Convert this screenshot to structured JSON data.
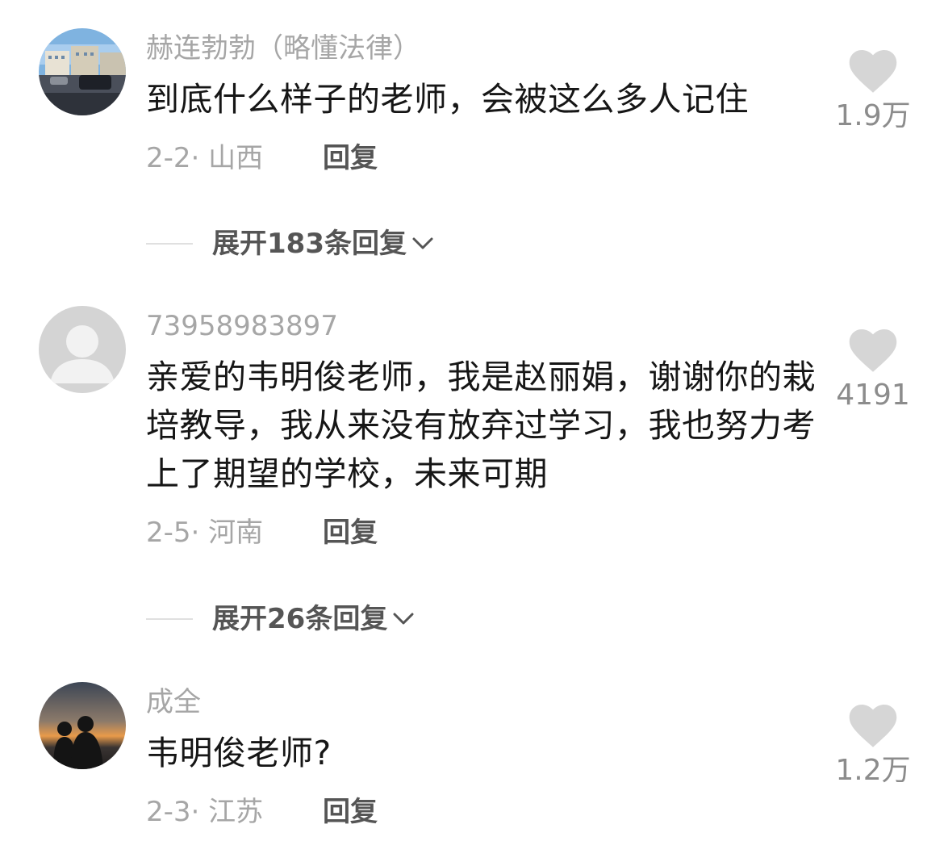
{
  "comments": [
    {
      "username": "赫连勃勃（略懂法律）",
      "text": "到底什么样子的老师，会被这么多人记住",
      "date_location": "2-2· 山西",
      "reply_label": "回复",
      "likes": "1.9万",
      "expand_label": "展开183条回复",
      "avatar_icon": "street-photo-avatar"
    },
    {
      "username": "73958983897",
      "text": "亲爱的韦明俊老师，我是赵丽娟，谢谢你的栽培教导，我从来没有放弃过学习，我也努力考上了期望的学校，未来可期",
      "date_location": "2-5· 河南",
      "reply_label": "回复",
      "likes": "4191",
      "expand_label": "展开26条回复",
      "avatar_icon": "default-user-avatar"
    },
    {
      "username": "成全",
      "text": "韦明俊老师?",
      "date_location": "2-3· 江苏",
      "reply_label": "回复",
      "likes": "1.2万",
      "avatar_icon": "sunset-silhouette-avatar"
    }
  ],
  "colors": {
    "username": "#a6a6a6",
    "content": "#161616",
    "like_icon": "#d6d6d6",
    "action_text": "#555555"
  }
}
